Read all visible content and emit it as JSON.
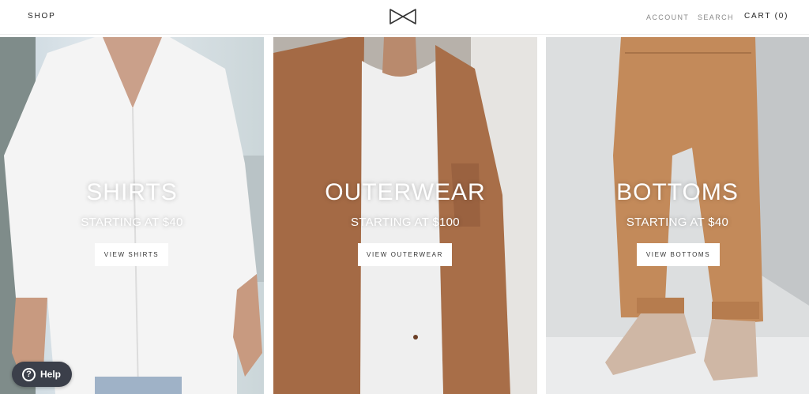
{
  "header": {
    "shop_label": "SHOP",
    "logo_icon": "bow-tie-icon",
    "account_label": "ACCOUNT",
    "search_label": "SEARCH",
    "cart_label": "CART (0)"
  },
  "categories": [
    {
      "title": "SHIRTS",
      "subtitle": "STARTING AT $40",
      "button_label": "VIEW SHIRTS"
    },
    {
      "title": "OUTERWEAR",
      "subtitle": "STARTING AT $100",
      "button_label": "VIEW OUTERWEAR"
    },
    {
      "title": "BOTTOMS",
      "subtitle": "STARTING AT $40",
      "button_label": "VIEW BOTTOMS"
    }
  ],
  "help": {
    "label": "Help",
    "icon": "question-circle-icon"
  },
  "colors": {
    "text_dark": "#222222",
    "text_muted": "#8a8a8a",
    "help_bg": "#3b3f4a",
    "jacket": "#a46a45",
    "pants": "#c38a5a"
  }
}
